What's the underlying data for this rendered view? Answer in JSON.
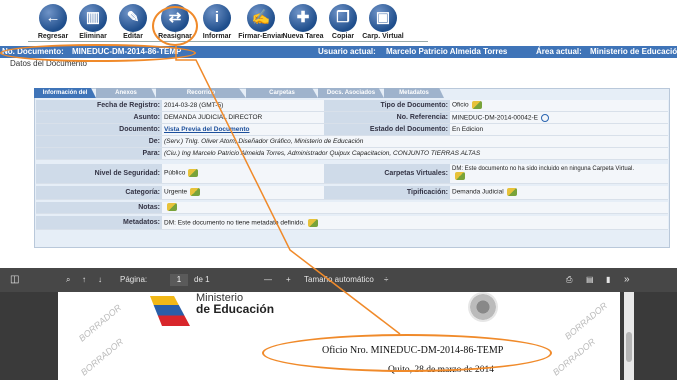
{
  "toolbar": {
    "buttons": [
      {
        "label": "Regresar",
        "icon": "back-arrow-icon",
        "glyph": "←"
      },
      {
        "label": "Eliminar",
        "icon": "trash-icon",
        "glyph": "▥"
      },
      {
        "label": "Editar",
        "icon": "edit-icon",
        "glyph": "✎"
      },
      {
        "label": "Reasignar",
        "icon": "reassign-icon",
        "glyph": "⇄"
      },
      {
        "label": "Informar",
        "icon": "info-icon",
        "glyph": "i"
      },
      {
        "label": "Firmar-Enviar",
        "icon": "sign-send-icon",
        "glyph": "✍"
      },
      {
        "label": "Nueva Tarea",
        "icon": "new-task-icon",
        "glyph": "✚"
      },
      {
        "label": "Copiar",
        "icon": "copy-icon",
        "glyph": "❐"
      },
      {
        "label": "Carp. Virtual",
        "icon": "virtual-folder-icon",
        "glyph": "▣"
      }
    ]
  },
  "infobar": {
    "doc_label": "No. Documento:",
    "doc_value": "MINEDUC-DM-2014-86-TEMP",
    "user_label": "Usuario actual:",
    "user_value": "Marcelo Patricio Almeida Torres",
    "area_label": "Área actual:",
    "area_value": "Ministerio de Educación"
  },
  "section_title": "Datos del Documento",
  "tabs": [
    "Información del Docu...",
    "Anexos",
    "Recorrido",
    "Carpetas",
    "Docs. Asociados",
    "Metadatos"
  ],
  "fields": {
    "fecha_label": "Fecha de Registro:",
    "fecha_value": "2014-03-28 (GMT-5)",
    "tipo_label": "Tipo de Documento:",
    "tipo_value": "Oficio",
    "asunto_label": "Asunto:",
    "asunto_value": "DEMANDA JUDICIAL DIRECTOR",
    "ref_label": "No. Referencia:",
    "ref_value": "MINEDUC-DM-2014-00042-E",
    "documento_label": "Documento:",
    "documento_value": "Vista Previa del Documento",
    "estado_label": "Estado del Documento:",
    "estado_value": "En Edicion",
    "de_label": "De:",
    "de_value": "(Serv.) Tnlg. Oliver Atom, Diseñador Gráfico, Ministerio de Educación",
    "para_label": "Para:",
    "para_value": "(Ciu.) Ing Marcelo Patricio Almeida Torres, Administrador Quipux Capacitacion, CONJUNTO TIERRAS ALTAS",
    "nivel_label": "Nivel de Seguridad:",
    "nivel_value": "Público",
    "carpetas_label": "Carpetas Virtuales:",
    "carpetas_value": "DM: Este documento no ha sido incluido en ninguna Carpeta Virtual.",
    "categoria_label": "Categoría:",
    "categoria_value": "Urgente",
    "tipificacion_label": "Tipificación:",
    "tipificacion_value": "Demanda Judicial",
    "notas_label": "Notas:",
    "metadatos_label": "Metadatos:",
    "metadatos_value": "DM: Este documento no tiene metadato definido."
  },
  "viewer": {
    "page_label": "Página:",
    "page_value": "1",
    "page_total": "de 1",
    "zoom_minus": "—",
    "zoom_plus": "+",
    "zoom_value": "Tamaño automático",
    "zoom_caret": "÷",
    "ministerio_line1": "Ministerio",
    "ministerio_line2": "de Educación",
    "watermark": "BORRADOR",
    "oficio_text": "Oficio Nro. MINEDUC-DM-2014-86-TEMP",
    "fecha_text": "Quito, 28 de marzo de 2014"
  }
}
